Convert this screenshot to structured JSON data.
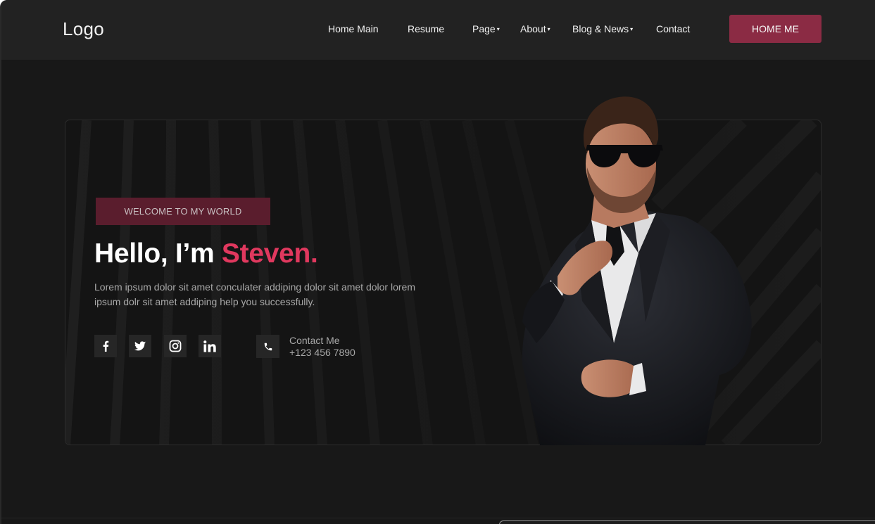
{
  "header": {
    "logo": "Logo",
    "nav": [
      {
        "label": "Home Main",
        "dropdown": false
      },
      {
        "label": "Resume",
        "dropdown": false
      },
      {
        "label": "Page",
        "dropdown": true
      },
      {
        "label": "About",
        "dropdown": true
      },
      {
        "label": "Blog & News",
        "dropdown": true
      },
      {
        "label": "Contact",
        "dropdown": false
      }
    ],
    "dropdown_caret": "▾",
    "cta_label": "HOME ME"
  },
  "hero": {
    "badge": "WELCOME TO MY WORLD",
    "greeting": "Hello, I’m",
    "name": "Steven.",
    "description": "Lorem ipsum dolor sit amet conculater addiping dolor sit amet dolor lorem ipsum dolr sit amet addiping help you successfully.",
    "social_icons": [
      "facebook-icon",
      "twitter-icon",
      "instagram-icon",
      "linkedin-icon"
    ],
    "contact": {
      "icon": "phone-icon",
      "label": "Contact Me",
      "phone": "+123 456 7890"
    },
    "portrait": "man-in-suit-with-sunglasses"
  },
  "colors": {
    "page_bg": "#181818",
    "header_bg": "#222222",
    "accent": "#8b2b44",
    "name_highlight": "#e0385e",
    "badge_bg": "#5a1d2d"
  }
}
